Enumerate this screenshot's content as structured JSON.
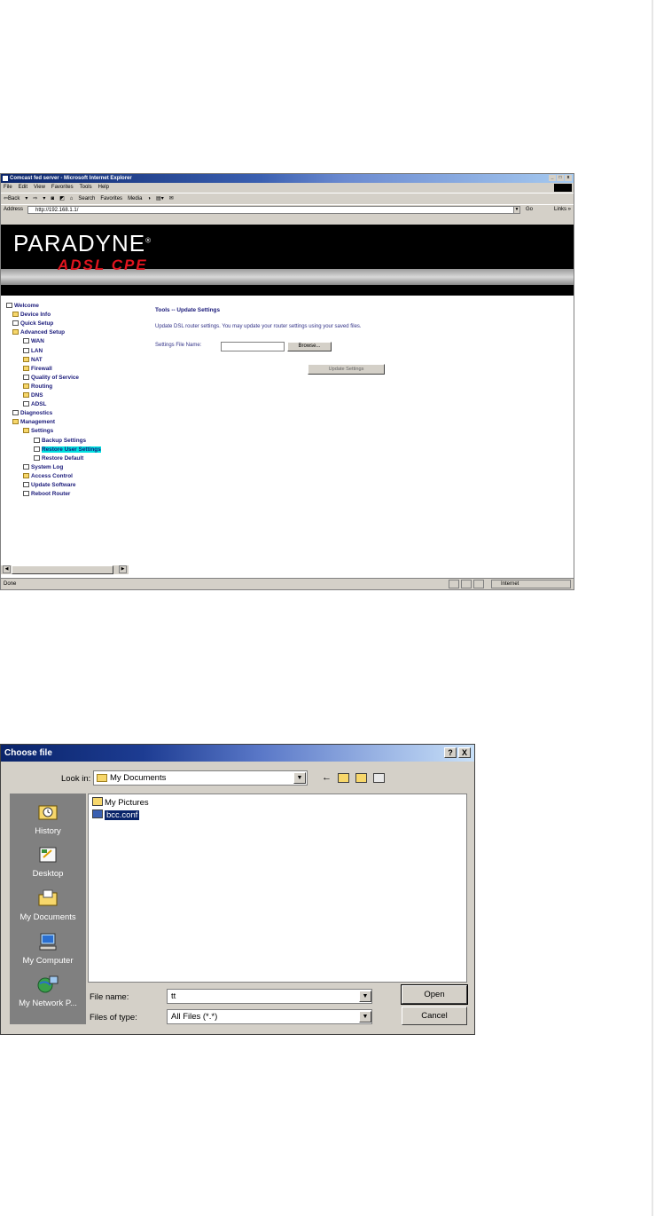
{
  "browser": {
    "title": "Comcast fed server - Microsoft Internet Explorer",
    "window_buttons": [
      "_",
      "□",
      "x"
    ],
    "menu": [
      "File",
      "Edit",
      "View",
      "Favorites",
      "Tools",
      "Help"
    ],
    "toolbar": [
      "⇦Back",
      "▾",
      "⇨",
      "▾",
      "◙",
      "◩",
      "⌂",
      "Search",
      "Favorites",
      "Media",
      "◑",
      "▤▾",
      "✉"
    ],
    "address_label": "Address",
    "address": "http://192.168.1.1/",
    "go_label": "Go",
    "links_label": "Links »",
    "brand": "PARADYNE",
    "brand_mark": "®",
    "brand_sub": "ADSL CPE",
    "nav": [
      {
        "label": "Welcome",
        "type": "page"
      },
      {
        "label": "Device Info",
        "type": "folder"
      },
      {
        "label": "Quick Setup",
        "type": "page"
      },
      {
        "label": "Advanced Setup",
        "type": "folder"
      },
      {
        "label": "WAN",
        "type": "page"
      },
      {
        "label": "LAN",
        "type": "page"
      },
      {
        "label": "NAT",
        "type": "folder"
      },
      {
        "label": "Firewall",
        "type": "folder"
      },
      {
        "label": "Quality of Service",
        "type": "page"
      },
      {
        "label": "Routing",
        "type": "folder"
      },
      {
        "label": "DNS",
        "type": "folder"
      },
      {
        "label": "ADSL",
        "type": "page"
      },
      {
        "label": "Diagnostics",
        "type": "page"
      },
      {
        "label": "Management",
        "type": "folder"
      },
      {
        "label": "Settings",
        "type": "folder"
      },
      {
        "label": "Backup Settings",
        "type": "page"
      },
      {
        "label": "Restore User Settings",
        "type": "page",
        "selected": true
      },
      {
        "label": "Restore Default",
        "type": "page"
      },
      {
        "label": "System Log",
        "type": "page"
      },
      {
        "label": "Access Control",
        "type": "folder"
      },
      {
        "label": "Update Software",
        "type": "page"
      },
      {
        "label": "Reboot Router",
        "type": "page"
      }
    ],
    "main": {
      "heading": "Tools -- Update Settings",
      "description": "Update DSL router settings. You may update your router settings using your saved files.",
      "file_label": "Settings File Name:",
      "browse_label": "Browse...",
      "update_label": "Update Settings"
    },
    "status_text": "Done",
    "zone_text": "Internet"
  },
  "dialog": {
    "title": "Choose file",
    "help_btn": "?",
    "close_btn": "X",
    "look_in_label": "Look in:",
    "look_in_value": "My Documents",
    "places": [
      "History",
      "Desktop",
      "My Documents",
      "My Computer",
      "My Network P..."
    ],
    "files": [
      {
        "name": "My Pictures",
        "type": "folder"
      },
      {
        "name": "bcc.conf",
        "type": "file",
        "selected": true
      }
    ],
    "file_name_label": "File name:",
    "file_name_value": "tt",
    "files_of_type_label": "Files of type:",
    "files_of_type_value": "All Files (*.*)",
    "open_label": "Open",
    "cancel_label": "Cancel"
  },
  "colors": {
    "titlebar": "#0a246a",
    "tree_text": "#1a1a7a",
    "tree_selected": "#00e0e0",
    "brand_red": "#e0141e"
  }
}
